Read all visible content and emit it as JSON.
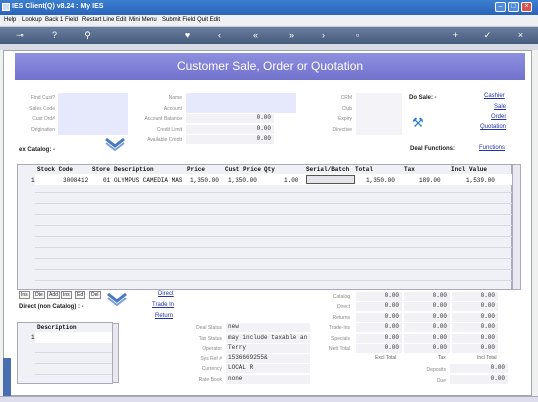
{
  "window": {
    "title": "IES Client(Q) v8.24 : My IES"
  },
  "menu": [
    "Help",
    "Lookup",
    "Back 1 Field",
    "Restart Line Edit",
    "Mini Menu",
    "Submit Field",
    "Quit Edit"
  ],
  "header": {
    "title": "Customer Sale, Order or Quotation"
  },
  "customer_fields": {
    "find_cust": "Find Cust?",
    "sales_code": "Sales Code",
    "cust_ord": "Cust Ord#",
    "origination": "Origination"
  },
  "account_fields": {
    "name": "Name",
    "account": "Account",
    "account_balance": "Account Balance",
    "credit_limit": "Credit Limit",
    "available_credit": "Available Credit"
  },
  "account_values": {
    "account_balance": "0.00",
    "credit_limit": "0.00",
    "available_credit": "0.00"
  },
  "crm_fields": {
    "crm": "CRM",
    "club": "Club",
    "expiry": "Expiry",
    "directive": "Directive"
  },
  "do_sale": {
    "label": "Do Sale: -",
    "options": [
      "Cashier",
      "Sale",
      "Order",
      "Quotation"
    ]
  },
  "catalog": {
    "label": "ex Catalog: -",
    "deal_functions": "Deal Functions:",
    "functions_link": "Functions"
  },
  "grid": {
    "headers": [
      "Stock Code",
      "Store",
      "Description",
      "Price",
      "Cust Price",
      "Qty",
      "Serial/Batch",
      "Total",
      "Tax",
      "Incl Value"
    ],
    "rows": [
      [
        "1",
        "3008412",
        "01",
        "OLYMPUS CAMEDIA MAS",
        "1,350.00",
        "1,350.00",
        "1.00",
        "",
        "1,350.00",
        "189.00",
        "1,539.00"
      ]
    ]
  },
  "row_buttons": [
    "Ins",
    "Dte",
    "Add",
    "Ins",
    "Ed",
    "Del"
  ],
  "direct_links": [
    "Direct",
    "Trade In",
    "Return"
  ],
  "direct_non_catalog": {
    "label": "Direct (non Catalog) : -",
    "header": "Description",
    "row_number": "1"
  },
  "deal_info": {
    "labels": [
      "Deal Status",
      "Tax Status",
      "Operator",
      "Sys Ref #",
      "Currency",
      "Rate Book"
    ],
    "values": [
      "new",
      "may include taxable an",
      "Terry",
      "1536669255&",
      "LOCAL R",
      "none"
    ]
  },
  "totals": {
    "rows": [
      {
        "label": "Catalog",
        "values": [
          "0.00",
          "0.00",
          "0.00"
        ]
      },
      {
        "label": "Direct",
        "values": [
          "0.00",
          "0.00",
          "0.00"
        ]
      },
      {
        "label": "Returns",
        "values": [
          "0.00",
          "0.00",
          "0.00"
        ]
      },
      {
        "label": "Trade-Ins",
        "values": [
          "0.00",
          "0.00",
          "0.00"
        ]
      },
      {
        "label": "Specials",
        "values": [
          "0.00",
          "0.00",
          "0.00"
        ]
      },
      {
        "label": "Nett Total",
        "values": [
          "0.00",
          "0.00",
          "0.00"
        ]
      }
    ],
    "col_labels": [
      "Excl Total",
      "Tax",
      "Incl Total"
    ],
    "deposits_label": "Deposits",
    "deposits_value": "0.00",
    "due_label": "Due",
    "due_value": "0.00"
  },
  "colors": {
    "title_bar": "#2b63b8",
    "header_band": "#7878d0",
    "field_bg": "#e6e8fb",
    "link": "#2233aa"
  },
  "icons": [
    "monitor-icon",
    "key-icon",
    "help-icon",
    "search-icon",
    "heart-icon",
    "back-icon",
    "rewind-icon",
    "forward-icon",
    "forward-fast-icon",
    "document-icon",
    "copy-icon",
    "add-icon",
    "check-icon",
    "close-icon",
    "wrench-icon",
    "chevron-down-icon"
  ]
}
